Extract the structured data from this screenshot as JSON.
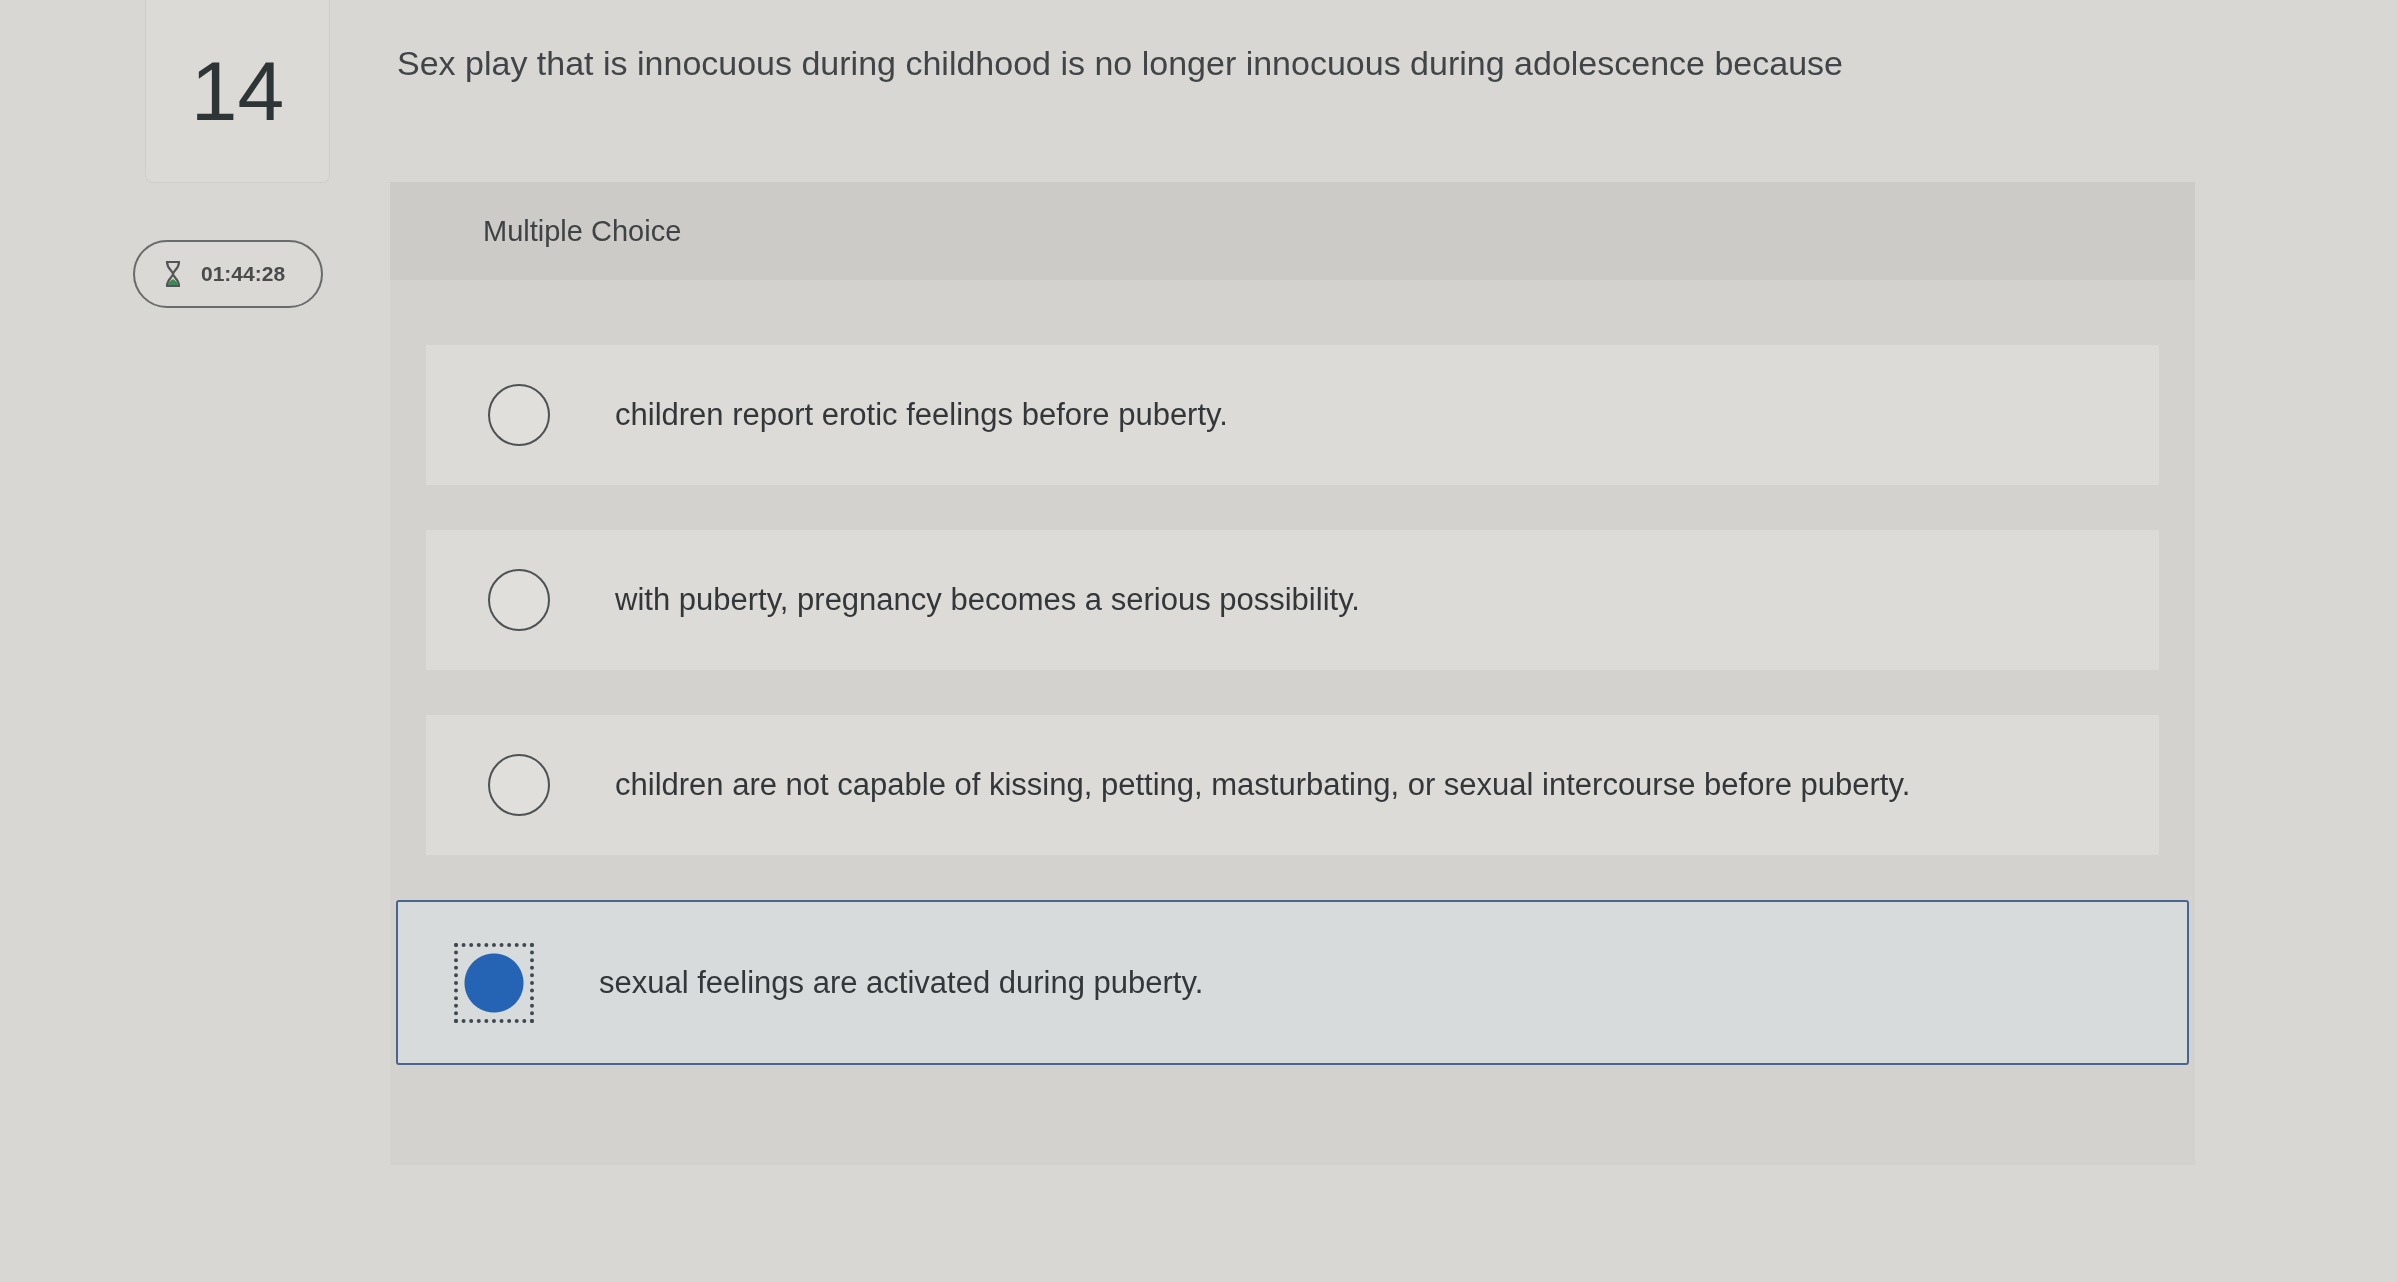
{
  "question": {
    "number": "14",
    "timer": "01:44:28",
    "text": "Sex play that is innocuous during childhood is no longer innocuous during adolescence because"
  },
  "answer_panel": {
    "type_label": "Multiple Choice",
    "options": [
      {
        "text": "children report erotic feelings before puberty.",
        "selected": false
      },
      {
        "text": "with puberty, pregnancy becomes a serious possibility.",
        "selected": false
      },
      {
        "text": "children are not capable of kissing, petting, masturbating, or sexual intercourse before puberty.",
        "selected": false
      },
      {
        "text": "sexual feelings are activated during puberty.",
        "selected": true
      }
    ]
  }
}
